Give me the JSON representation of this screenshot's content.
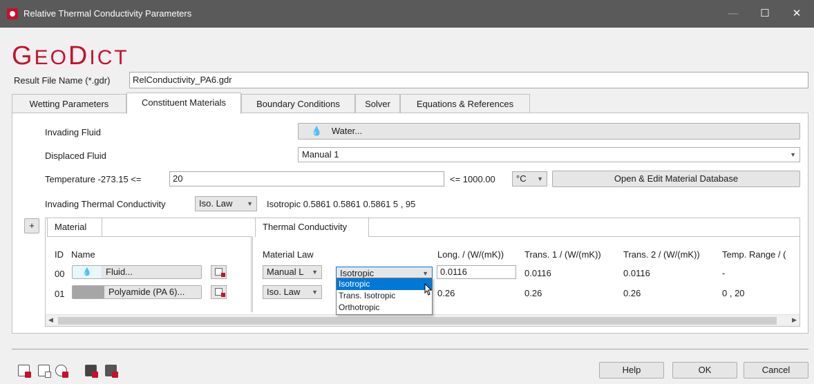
{
  "window": {
    "title": "Relative Thermal Conductivity Parameters",
    "minimize": "—",
    "maximize": "☐",
    "close": "✕"
  },
  "logo": {
    "first": "G",
    "rest": "EO",
    "second": "D",
    "rest2": "ICT"
  },
  "result_file": {
    "label": "Result File Name (*.gdr)",
    "value": "RelConductivity_PA6.gdr"
  },
  "tabs": [
    "Wetting Parameters",
    "Constituent Materials",
    "Boundary Conditions",
    "Solver",
    "Equations & References"
  ],
  "invading_fluid": {
    "label": "Invading Fluid",
    "button": "Water..."
  },
  "displaced_fluid": {
    "label": "Displaced Fluid",
    "value": "Manual 1"
  },
  "temperature": {
    "label": "Temperature  -273.15 <=",
    "value": "20",
    "max_label": "<= 1000.00",
    "unit": "°C",
    "db_button": "Open & Edit Material Database"
  },
  "invading_conductivity": {
    "label": "Invading Thermal Conductivity",
    "law": "Iso. Law",
    "value": "Isotropic 0.5861 0.5861 0.5861 5 , 95"
  },
  "plus_button": "+",
  "material_tab": "Material",
  "conductivity_tab": "Thermal Conductivity",
  "material_headers": {
    "id": "ID",
    "name": "Name"
  },
  "conductivity_headers": [
    "Material Law",
    "Long. / (W/(mK))",
    "Trans. 1 / (W/(mK))",
    "Trans. 2 / (W/(mK))",
    "Temp. Range / ("
  ],
  "materials": [
    {
      "id": "00",
      "name": "Fluid...",
      "law": "Manual L",
      "type": "Isotropic",
      "long": "0.0116",
      "trans1": "0.0116",
      "trans2": "0.0116",
      "range": "-"
    },
    {
      "id": "01",
      "name": "Polyamide (PA 6)...",
      "law": "Iso. Law",
      "long": "0.26",
      "trans1": "0.26",
      "trans2": "0.26",
      "range": "0 , 20"
    }
  ],
  "dropdown_options": [
    "Isotropic",
    "Trans. Isotropic",
    "Orthotropic"
  ],
  "footer": {
    "help": "Help",
    "ok": "OK",
    "cancel": "Cancel"
  },
  "colors": {
    "accent": "#c8102e",
    "titlebar": "#5a5a5a",
    "selection": "#0078d7"
  }
}
